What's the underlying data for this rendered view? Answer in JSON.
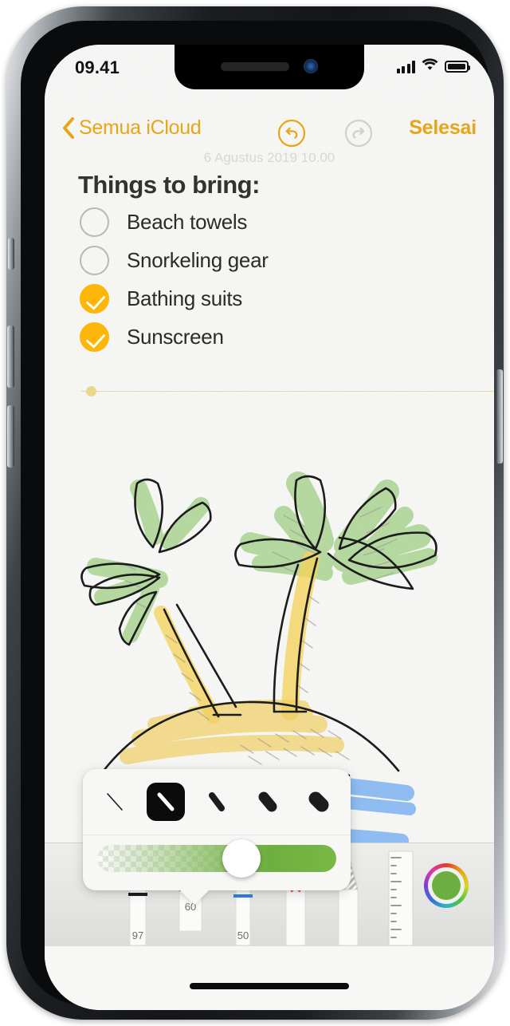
{
  "status_bar": {
    "time": "09.41",
    "signal_icon": "cellular-signal-icon",
    "wifi_icon": "wifi-icon",
    "battery_icon": "battery-full-icon"
  },
  "nav_bar": {
    "back_label": "Semua iCloud",
    "back_icon": "chevron-left-icon",
    "undo_icon": "undo-arrow-icon",
    "redo_icon": "redo-arrow-icon",
    "done_label": "Selesai",
    "undo_enabled_color": "#e8a516",
    "redo_disabled_color": "#cfcfcb"
  },
  "note": {
    "date": "6 Agustus 2019 10.00",
    "title": "Things to bring:",
    "checklist": [
      {
        "label": "Beach towels",
        "checked": false
      },
      {
        "label": "Snorkeling gear",
        "checked": false
      },
      {
        "label": "Bathing suits",
        "checked": true
      },
      {
        "label": "Sunscreen",
        "checked": true
      }
    ]
  },
  "drawing": {
    "description": "two palm trees on a sandy island with blue water",
    "colors": {
      "leaf_green": "#9ccd7f",
      "trunk_yellow": "#f5d35c",
      "sand_yellow": "#f0cf63",
      "water_blue": "#5b9ff0",
      "ink_black": "#1c1c1c",
      "pencil_gray": "#9a9a96"
    }
  },
  "stroke_popover": {
    "options": [
      {
        "name": "stroke-hairline",
        "width": 2,
        "selected": false
      },
      {
        "name": "stroke-thin",
        "width": 7,
        "selected": true
      },
      {
        "name": "stroke-medium",
        "width": 12,
        "selected": false
      },
      {
        "name": "stroke-thick",
        "width": 17,
        "selected": false
      },
      {
        "name": "stroke-thickest",
        "width": 22,
        "selected": false
      }
    ],
    "opacity_slider": {
      "name": "opacity-slider",
      "value_percent": 55,
      "track_color": "#6daf3f"
    }
  },
  "tool_bar": {
    "tools": [
      {
        "name": "pen-tool",
        "number": "97",
        "tip_color": "#1c1c1c",
        "selected": false
      },
      {
        "name": "highlighter-tool",
        "number": "60",
        "tip_color": "#6cae3f",
        "selected": true
      },
      {
        "name": "pencil-tool",
        "number": "50",
        "tip_color": "#2e7fe8",
        "selected": false
      },
      {
        "name": "eraser-tool",
        "number": "",
        "tip_color": "#dc8a8a",
        "selected": false
      },
      {
        "name": "lasso-tool",
        "number": "",
        "tip_color": "#b9b9b5",
        "selected": false
      },
      {
        "name": "ruler-tool",
        "number": "",
        "tip_color": "#d8d8d4",
        "selected": false
      }
    ],
    "color_picker": {
      "name": "color-picker-button",
      "current_color": "#6cae3f"
    }
  },
  "home_indicator": {
    "name": "home-indicator"
  }
}
